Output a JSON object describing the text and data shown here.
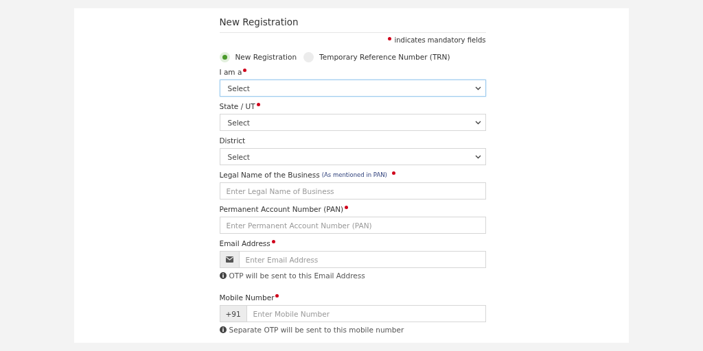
{
  "title": "New Registration",
  "mandatory_note": "indicates mandatory fields",
  "options": [
    {
      "label": "New Registration",
      "selected": true
    },
    {
      "label": "Temporary Reference Number (TRN)",
      "selected": false
    }
  ],
  "fields": [
    {
      "kind": "select",
      "label": "I am a",
      "required": true,
      "value": "Select",
      "focused": true
    },
    {
      "kind": "select",
      "label": "State / UT",
      "required": true,
      "value": "Select",
      "focused": false
    },
    {
      "kind": "select",
      "label": "District",
      "required": false,
      "value": "Select",
      "focused": false
    },
    {
      "kind": "text",
      "label": "Legal Name of the Business",
      "note": "(As mentioned in PAN)",
      "required": true,
      "placeholder": "Enter Legal Name of Business"
    },
    {
      "kind": "text",
      "label": "Permanent Account Number (PAN)",
      "required": true,
      "placeholder": "Enter Permanent Account Number (PAN)"
    },
    {
      "kind": "email",
      "label": "Email Address",
      "required": true,
      "placeholder": "Enter Email Address",
      "help": "OTP will be sent to this Email Address"
    },
    {
      "kind": "phone",
      "label": "Mobile Number",
      "required": true,
      "prefix": "+91",
      "placeholder": "Enter Mobile Number",
      "help": "Separate OTP will be sent to this mobile number"
    }
  ]
}
